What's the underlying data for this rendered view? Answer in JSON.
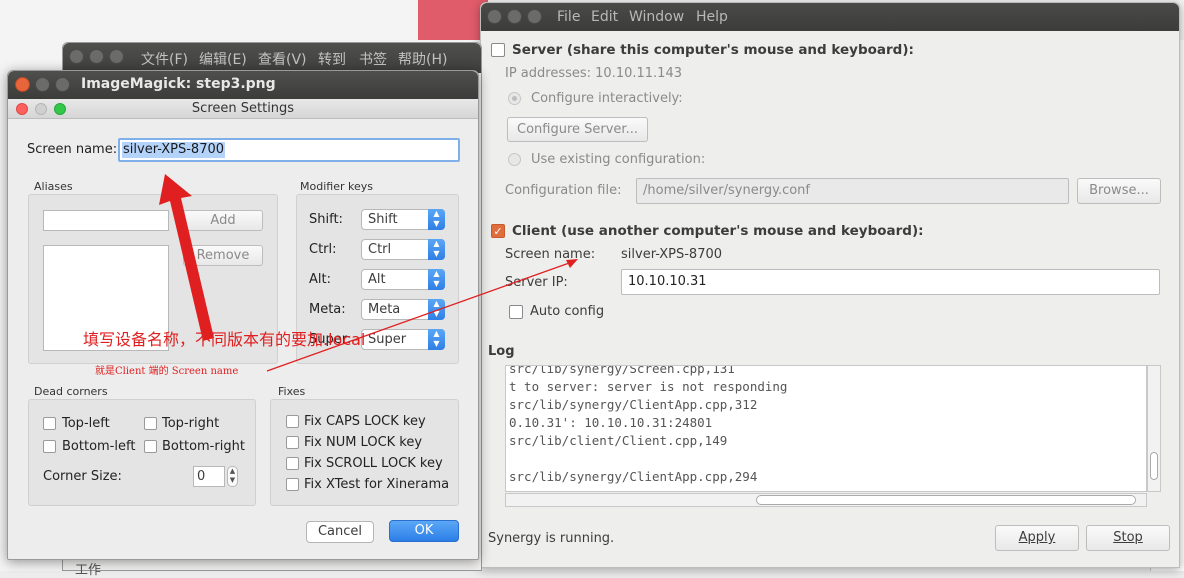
{
  "colors": {
    "accent": "#e06d3e",
    "annotation": "#e02020",
    "ok_button": "#2c7ee6"
  },
  "synergy": {
    "menu": [
      "File",
      "Edit",
      "Window",
      "Help"
    ],
    "server_checkbox": "Server (share this computer's mouse and keyboard):",
    "ip_addresses": "IP addresses:  10.10.11.143",
    "configure_interactively": "Configure interactively:",
    "configure_server_button": "Configure Server...",
    "use_existing": "Use existing configuration:",
    "config_file_label": "Configuration file:",
    "config_file_value": "/home/silver/synergy.conf",
    "browse_button": "Browse...",
    "client_checkbox": "Client (use another computer's mouse and keyboard):",
    "screen_name_label": "Screen name:",
    "screen_name_value": "silver-XPS-8700",
    "server_ip_label": "Server IP:",
    "server_ip_value": "10.10.10.31",
    "auto_config": "Auto config",
    "log_label": "Log",
    "log_lines": [
      "src/lib/synergy/Screen.cpp,131",
      "t to server: server is not responding",
      "src/lib/synergy/ClientApp.cpp,312",
      "0.10.31': 10.10.10.31:24801",
      "src/lib/client/Client.cpp,149",
      "",
      "src/lib/synergy/ClientApp.cpp,294"
    ],
    "status": "Synergy is running.",
    "apply_button": "Apply",
    "stop_button": "Stop"
  },
  "cn_window": {
    "menu": [
      "文件(F)",
      "编辑(E)",
      "查看(V)",
      "转到",
      "书签",
      "帮助(H)"
    ],
    "bottom_item": "工作"
  },
  "imagemagick": {
    "title": "ImageMagick: step3.png",
    "dialog_title": "Screen Settings",
    "screen_name_label": "Screen name:",
    "screen_name_value": "silver-XPS-8700",
    "aliases_title": "Aliases",
    "add_button": "Add",
    "remove_button": "Remove",
    "modifier_title": "Modifier keys",
    "modifiers": [
      {
        "label": "Shift:",
        "value": "Shift"
      },
      {
        "label": "Ctrl:",
        "value": "Ctrl"
      },
      {
        "label": "Alt:",
        "value": "Alt"
      },
      {
        "label": "Meta:",
        "value": "Meta"
      },
      {
        "label": "Super:",
        "value": "Super"
      }
    ],
    "dead_corners_title": "Dead corners",
    "corners": [
      "Top-left",
      "Top-right",
      "Bottom-left",
      "Bottom-right"
    ],
    "corner_size_label": "Corner Size:",
    "corner_size_value": "0",
    "fixes_title": "Fixes",
    "fixes": [
      "Fix CAPS LOCK key",
      "Fix NUM LOCK key",
      "Fix SCROLL LOCK key",
      "Fix XTest for Xinerama"
    ],
    "cancel_button": "Cancel",
    "ok_button": "OK"
  },
  "annotations": {
    "main_note": "填写设备名称，不同版本有的要加.local",
    "sub_note": "就是Client 端的 Screen name"
  }
}
